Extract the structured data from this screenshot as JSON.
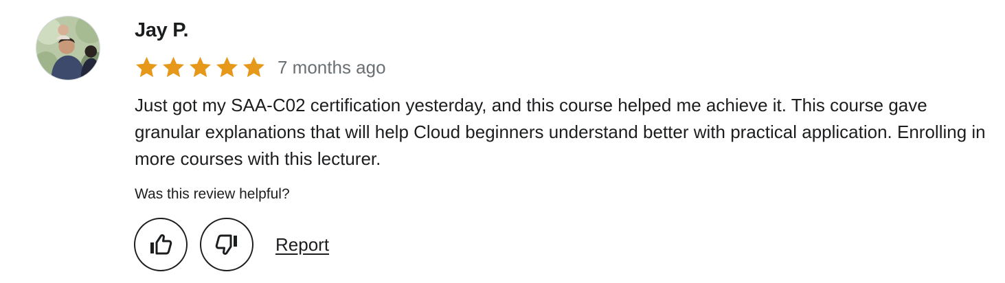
{
  "review": {
    "reviewer_name": "Jay P.",
    "avatar": {
      "icon": "user-photo-avatar"
    },
    "rating": {
      "value": 5,
      "max": 5,
      "color": "#e59819"
    },
    "date": "7 months ago",
    "text": "Just got my SAA-C02 certification yesterday, and this course helped me achieve it. This course gave granular explanations that will help Cloud beginners understand better with practical application. Enrolling in more courses with this lecturer.",
    "helpful_prompt": "Was this review helpful?",
    "actions": {
      "helpful_icon": "thumbs-up-icon",
      "not_helpful_icon": "thumbs-down-icon",
      "report_label": "Report"
    }
  }
}
